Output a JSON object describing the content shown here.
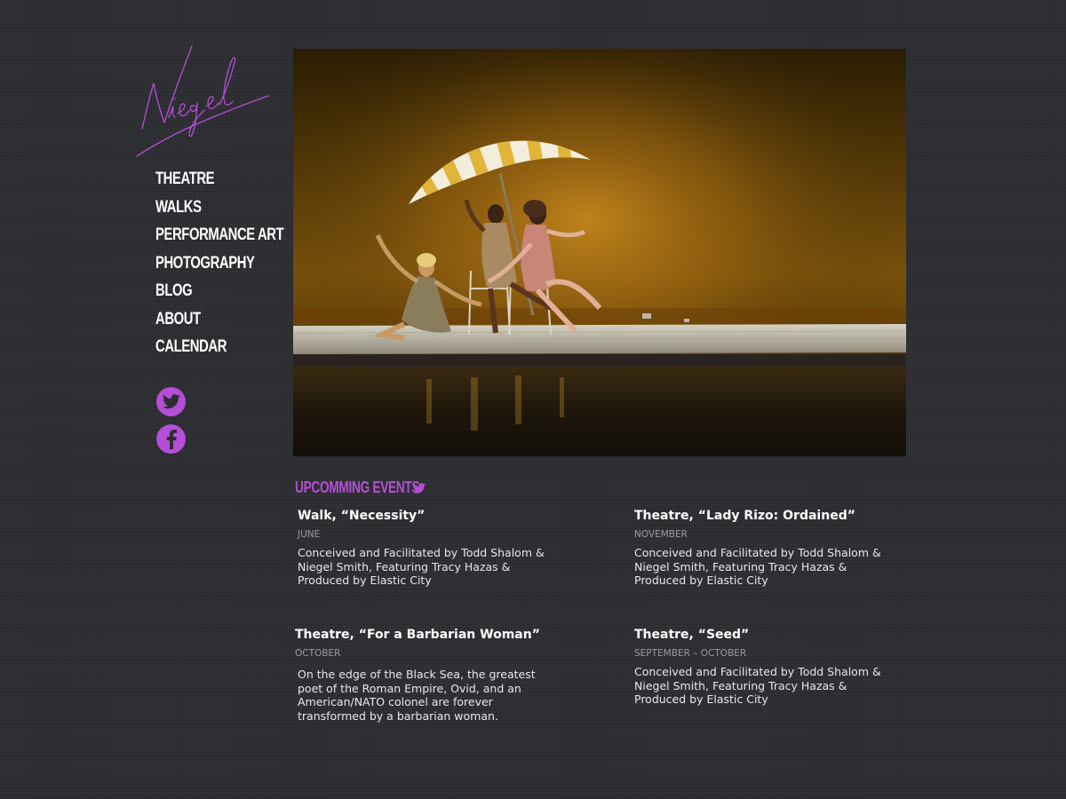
{
  "logo": {
    "text": "Niegel",
    "color": "#b54ed6"
  },
  "nav": {
    "items": [
      {
        "label": "Theatre"
      },
      {
        "label": "Walks"
      },
      {
        "label": "Performance Art"
      },
      {
        "label": "Photography"
      },
      {
        "label": "Blog"
      },
      {
        "label": "About"
      },
      {
        "label": "Calendar"
      }
    ]
  },
  "social": {
    "twitter_icon": "twitter-icon",
    "facebook_icon": "facebook-icon",
    "color": "#b54ed6"
  },
  "hero": {
    "image": "stage-photo-three-performers-under-striped-umbrella"
  },
  "events": {
    "heading": "Upcomming Events",
    "heading_icon": "twitter-bird-icon",
    "accent_color": "#b54ed6",
    "items": [
      {
        "title": "Walk, “Necessity”",
        "date": "June",
        "description": "Conceived and Facilitated by Todd Shalom & Niegel Smith, Featuring Tracy Hazas & Produced by Elastic City"
      },
      {
        "title": "Theatre, “Lady Rizo: Ordained”",
        "date": "November",
        "description": "Conceived and Facilitated by Todd Shalom & Niegel Smith, Featuring Tracy Hazas & Produced by Elastic City"
      },
      {
        "title": "Theatre, “For a Barbarian Woman”",
        "date": "October",
        "description": "On the edge of the Black Sea, the greatest poet of the Roman Empire, Ovid, and an American/NATO colonel are forever transformed by a barbarian woman."
      },
      {
        "title": "Theatre, “Seed”",
        "date": "September – October",
        "description": "Conceived and Facilitated by Todd Shalom & Niegel Smith, Featuring Tracy Hazas & Produced by Elastic City"
      }
    ]
  }
}
